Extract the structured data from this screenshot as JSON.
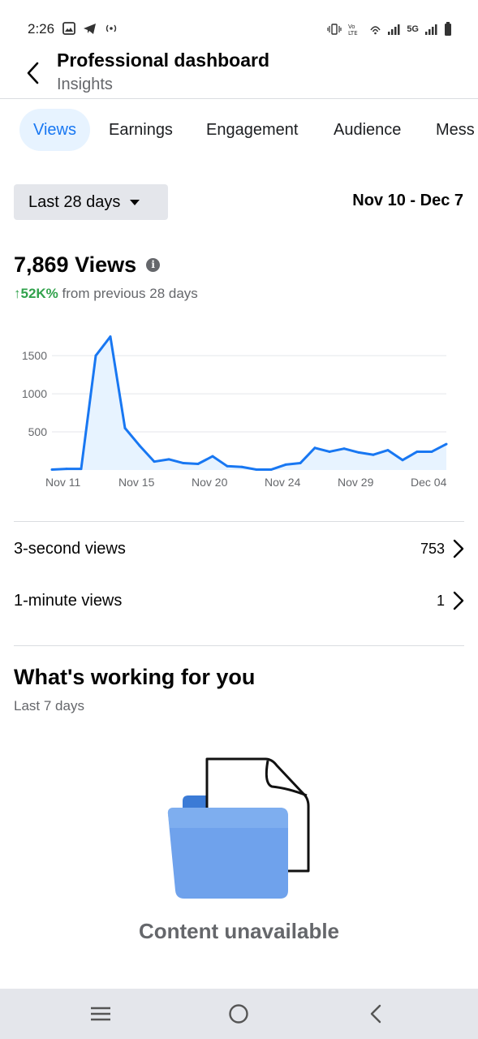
{
  "status_bar": {
    "time": "2:26",
    "network_label": "5G"
  },
  "header": {
    "title": "Professional dashboard",
    "subtitle": "Insights"
  },
  "tabs": [
    {
      "label": "Views",
      "active": true
    },
    {
      "label": "Earnings",
      "active": false
    },
    {
      "label": "Engagement",
      "active": false
    },
    {
      "label": "Audience",
      "active": false
    },
    {
      "label": "Mess",
      "active": false
    }
  ],
  "filter": {
    "range_label": "Last 28 days",
    "date_range": "Nov 10 - Dec 7"
  },
  "summary": {
    "views_title": "7,869 Views",
    "change_value": "↑52K%",
    "change_text": " from previous 28 days"
  },
  "chart_data": {
    "type": "area",
    "x_tick_labels": [
      "Nov 11",
      "Nov 15",
      "Nov 20",
      "Nov 24",
      "Nov 29",
      "Dec 04"
    ],
    "y_tick_labels": [
      "1500",
      "1000",
      "500"
    ],
    "ylim": [
      0,
      1800
    ],
    "grid": true,
    "color": "#1877f2",
    "fill_color": "#e7f3ff",
    "series": [
      {
        "values": [
          5,
          15,
          15,
          1500,
          1750,
          550,
          320,
          110,
          140,
          90,
          80,
          180,
          50,
          40,
          5,
          5,
          70,
          90,
          290,
          240,
          280,
          230,
          200,
          260,
          130,
          240,
          240,
          340
        ]
      }
    ]
  },
  "metrics": [
    {
      "label": "3-second views",
      "value": "753"
    },
    {
      "label": "1-minute views",
      "value": "1"
    }
  ],
  "working": {
    "title": "What's working for you",
    "subtitle": "Last 7 days",
    "empty_text": "Content unavailable"
  },
  "icons": {
    "back": "back-arrow-icon",
    "info": "info-icon",
    "chevron": "chevron-right-icon",
    "nav_menu": "recent-apps-icon",
    "nav_home": "home-icon",
    "nav_back": "nav-back-icon"
  },
  "info_glyph": "i"
}
